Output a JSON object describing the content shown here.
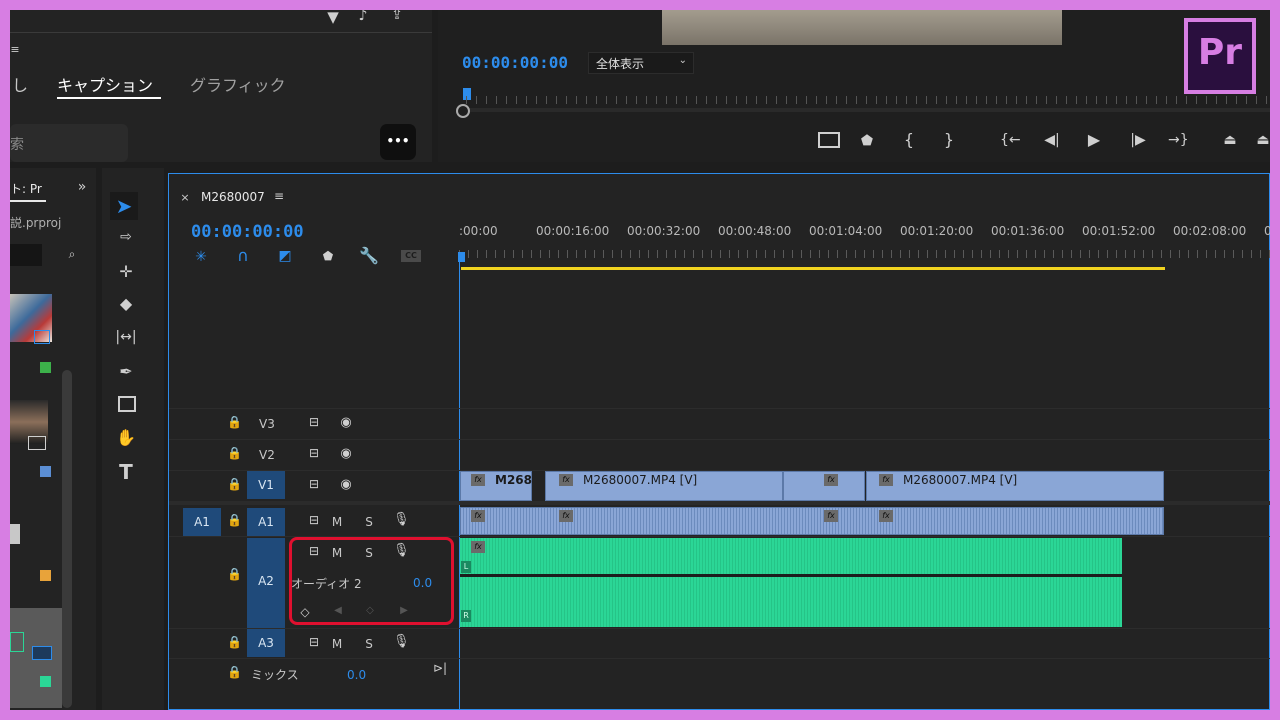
{
  "effects_panel": {
    "tab_partial": "し",
    "tab_captions": "キャプション",
    "tab_graphics": "グラフィック",
    "search_placeholder": "索",
    "more_button": "•••"
  },
  "program_monitor": {
    "timecode": "00:00:00:00",
    "fit_select": "全体表示"
  },
  "project_panel": {
    "tab_label": "ト: Pr",
    "project_file": "説.prproj"
  },
  "app_logo": "Pr",
  "timeline": {
    "sequence_name": "M2680007",
    "timecode": "00:00:00:00",
    "ruler_labels": [
      ":00:00",
      "00:00:16:00",
      "00:00:32:00",
      "00:00:48:00",
      "00:01:04:00",
      "00:01:20:00",
      "00:01:36:00",
      "00:01:52:00",
      "00:02:08:00",
      "00"
    ],
    "tracks": {
      "v3": "V3",
      "v2": "V2",
      "v1": "V1",
      "a1_src": "A1",
      "a1": "A1",
      "a2": "A2",
      "a3": "A3",
      "mute": "M",
      "solo": "S",
      "a2_name": "オーディオ 2",
      "a2_volume": "0.0",
      "mix_label": "ミックス",
      "mix_value": "0.0"
    },
    "clips": {
      "v1_clip1": "M268",
      "v1_clip2": "M2680007.MP4 [V]",
      "v1_clip3": "M2680007.MP4 [V]",
      "fx": "fx",
      "left_channel": "L",
      "right_channel": "R"
    }
  },
  "colors": {
    "accent_blue": "#2d8ceb",
    "video_clip": "#8aa6d6",
    "audio_clip": "#2bd696",
    "work_area": "#f1d31f",
    "highlight_box": "#e0102f"
  }
}
